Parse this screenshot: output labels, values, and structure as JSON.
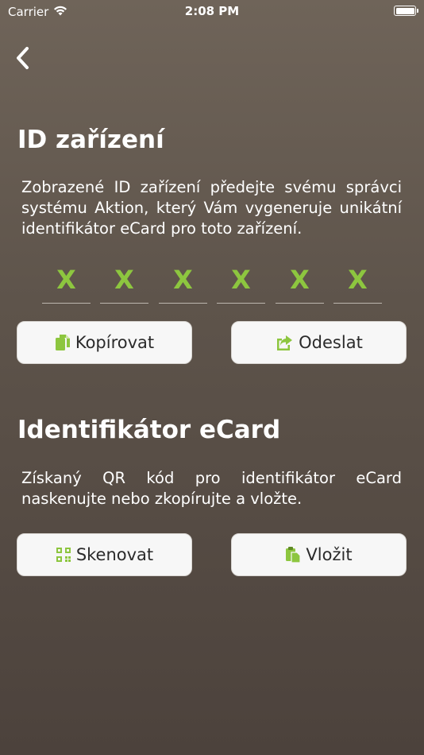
{
  "status": {
    "carrier": "Carrier",
    "time": "2:08 PM"
  },
  "device_section": {
    "title": "ID zařízení",
    "description": "Zobrazené ID zařízení předejte svému správci systému Aktion, který Vám vygeneruje unikátní identifikátor eCard pro toto zařízení.",
    "id_chars": [
      "X",
      "X",
      "X",
      "X",
      "X",
      "X"
    ],
    "copy_label": "Kopírovat",
    "send_label": "Odeslat"
  },
  "ecard_section": {
    "title": "Identifikátor eCard",
    "description": "Získaný QR kód pro identifikátor eCard naskenujte nebo zkopírujte a vložte.",
    "scan_label": "Skenovat",
    "paste_label": "Vložit"
  },
  "colors": {
    "accent": "#8dc63f",
    "background": "#5e544b",
    "button": "#f7f7f7"
  },
  "icons": [
    "wifi-icon",
    "battery-icon",
    "back-chevron-icon",
    "copy-icon",
    "share-icon",
    "qr-code-icon",
    "paste-icon"
  ]
}
